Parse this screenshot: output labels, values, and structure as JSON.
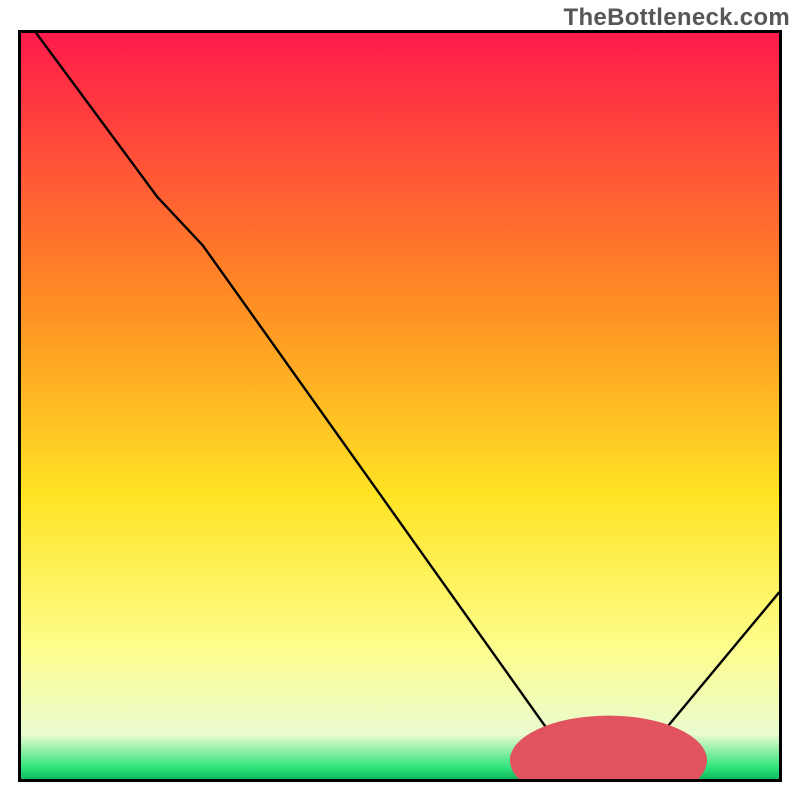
{
  "watermark": "TheBottleneck.com",
  "chart_data": {
    "type": "line",
    "title": "",
    "xlabel": "",
    "ylabel": "",
    "xlim": [
      0,
      100
    ],
    "ylim": [
      0,
      100
    ],
    "grid": false,
    "background_gradient": {
      "stops": [
        {
          "offset": 0.0,
          "color": "#ff1b4b"
        },
        {
          "offset": 0.35,
          "color": "#ff8a24"
        },
        {
          "offset": 0.62,
          "color": "#ffe424"
        },
        {
          "offset": 0.82,
          "color": "#fdfd8a"
        },
        {
          "offset": 0.94,
          "color": "#eafbcf"
        },
        {
          "offset": 0.985,
          "color": "#2ee37a"
        },
        {
          "offset": 1.0,
          "color": "#0fb85f"
        }
      ]
    },
    "curve": {
      "stroke": "#000000",
      "stroke_width": 2.4,
      "points": [
        {
          "x": 2.0,
          "y": 100.0
        },
        {
          "x": 18.0,
          "y": 78.0
        },
        {
          "x": 24.0,
          "y": 71.5
        },
        {
          "x": 72.0,
          "y": 3.0
        },
        {
          "x": 74.0,
          "y": 1.5
        },
        {
          "x": 80.0,
          "y": 1.5
        },
        {
          "x": 82.0,
          "y": 3.0
        },
        {
          "x": 100.0,
          "y": 25.0
        }
      ]
    },
    "marker": {
      "fill": "#e0535f",
      "rx": 13,
      "ry": 6,
      "cx": 77.5,
      "cy": 2.5
    }
  }
}
